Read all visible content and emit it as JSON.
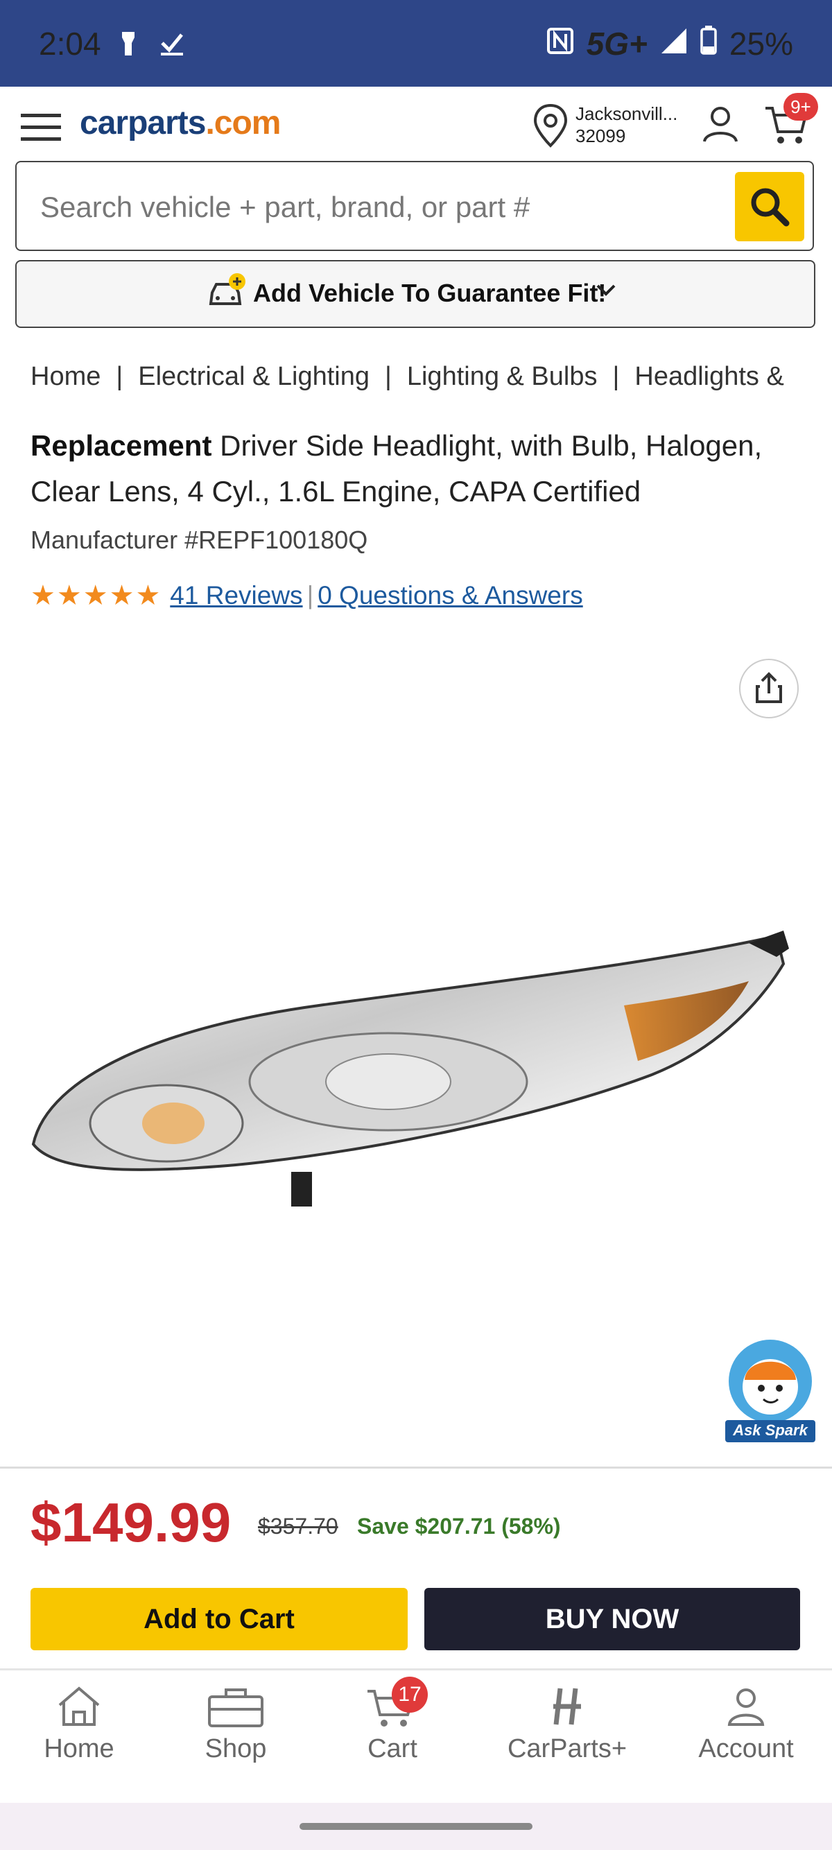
{
  "status_bar": {
    "time": "2:04",
    "network": "5G+",
    "battery": "25%"
  },
  "header": {
    "logo_main": "carparts",
    "logo_suffix": ".com",
    "location_city": "Jacksonvill...",
    "location_zip": "32099",
    "cart_badge": "9+"
  },
  "search": {
    "placeholder": "Search vehicle + part, brand, or part #"
  },
  "vehicle": {
    "label": "Add Vehicle To Guarantee Fit!"
  },
  "breadcrumb": [
    "Home",
    "Electrical & Lighting",
    "Lighting & Bulbs",
    "Headlights &"
  ],
  "product": {
    "brand": "Replacement",
    "title": "Driver Side Headlight, with Bulb, Halogen, Clear Lens, 4 Cyl., 1.6L Engine, CAPA Certified",
    "manufacturer": "Manufacturer #REPF100180Q",
    "rating_stars": 5,
    "reviews_link": "41 Reviews",
    "qa_link": "0 Questions & Answers"
  },
  "assistant": {
    "label": "Ask Spark"
  },
  "pricing": {
    "price": "$149.99",
    "original_price": "$357.70",
    "savings": "Save $207.71 (58%)"
  },
  "actions": {
    "add_to_cart": "Add to Cart",
    "buy_now": "BUY NOW"
  },
  "bottom_nav": {
    "items": [
      {
        "label": "Home",
        "icon": "home-icon"
      },
      {
        "label": "Shop",
        "icon": "toolbox-icon"
      },
      {
        "label": "Cart",
        "icon": "cart-icon",
        "badge": "17"
      },
      {
        "label": "CarParts+",
        "icon": "carparts-plus-icon"
      },
      {
        "label": "Account",
        "icon": "account-icon"
      }
    ]
  },
  "colors": {
    "status_bar": "#2e4688",
    "accent_yellow": "#f8c600",
    "price_red": "#c8282d",
    "link_blue": "#1d5a9e",
    "save_green": "#3a7a2a"
  }
}
